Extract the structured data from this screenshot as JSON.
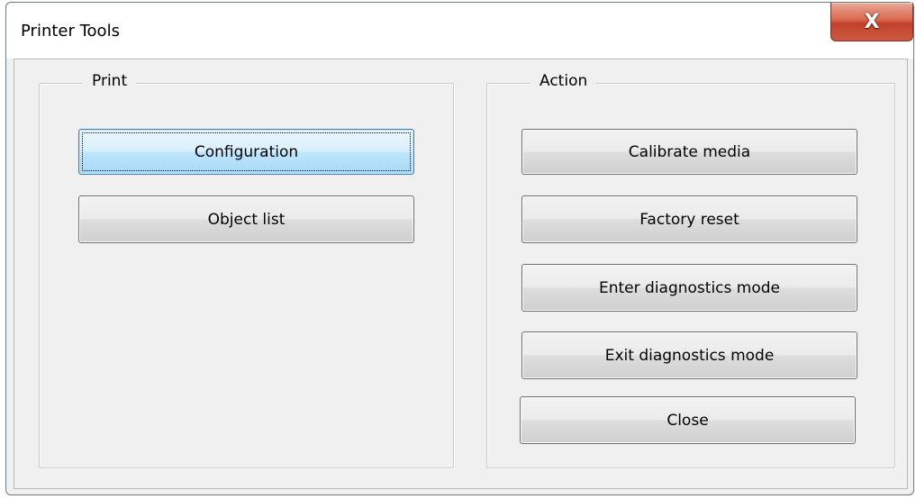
{
  "window": {
    "title": "Printer Tools",
    "close_glyph": "X"
  },
  "print_group": {
    "legend": "Print",
    "buttons": [
      "Configuration",
      "Object list"
    ]
  },
  "action_group": {
    "legend": "Action",
    "buttons": [
      "Calibrate media",
      "Factory reset",
      "Enter diagnostics mode",
      "Exit diagnostics mode"
    ]
  },
  "close_button": "Close",
  "colors": {
    "close_x_red": "#c2402a",
    "default_button_blue": "#bee6fd",
    "dialog_background": "#f0f0f0"
  }
}
